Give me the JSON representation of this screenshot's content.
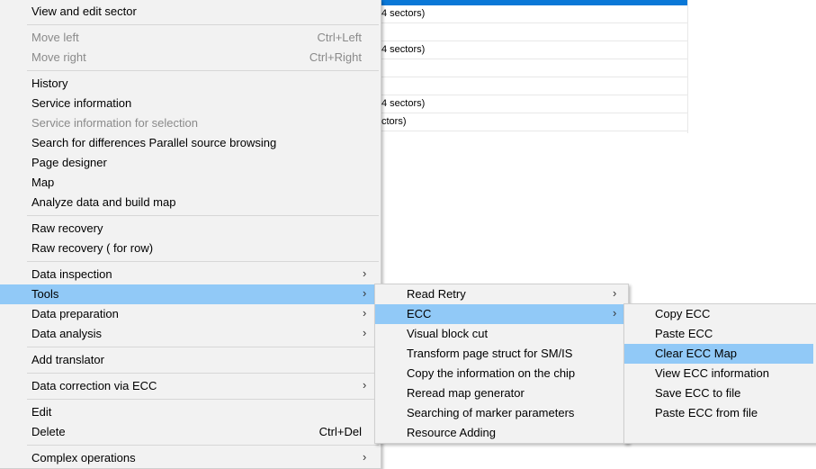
{
  "background": {
    "rows": [
      {
        "text": "4 sectors)"
      },
      {
        "text": ""
      },
      {
        "text": "4 sectors)"
      },
      {
        "text": ""
      },
      {
        "text": ""
      },
      {
        "text": "4 sectors)"
      },
      {
        "text": "ctors)"
      }
    ]
  },
  "main_menu": {
    "items": [
      {
        "label": "View and edit sector"
      },
      {
        "label": "Move left",
        "shortcut": "Ctrl+Left"
      },
      {
        "label": "Move right",
        "shortcut": "Ctrl+Right"
      },
      {
        "label": "History"
      },
      {
        "label": "Service information"
      },
      {
        "label": "Service information for selection"
      },
      {
        "label": "Search for differences Parallel source browsing"
      },
      {
        "label": "Page designer"
      },
      {
        "label": "Map"
      },
      {
        "label": "Analyze data and build map"
      },
      {
        "label": "Raw recovery"
      },
      {
        "label": "Raw recovery ( for row)"
      },
      {
        "label": "Data inspection"
      },
      {
        "label": "Tools"
      },
      {
        "label": "Data preparation"
      },
      {
        "label": "Data analysis"
      },
      {
        "label": "Add translator"
      },
      {
        "label": "Data correction via ECC"
      },
      {
        "label": "Edit"
      },
      {
        "label": "Delete",
        "shortcut": "Ctrl+Del"
      },
      {
        "label": "Complex operations"
      }
    ],
    "submenu_arrow": "chevron-right-icon"
  },
  "tools_menu": {
    "items": [
      {
        "label": "Read Retry"
      },
      {
        "label": "ECC"
      },
      {
        "label": "Visual block cut"
      },
      {
        "label": "Transform page struct for SM/IS"
      },
      {
        "label": "Copy the information on the chip"
      },
      {
        "label": "Reread map generator"
      },
      {
        "label": "Searching of marker parameters"
      },
      {
        "label": "Resource Adding"
      }
    ]
  },
  "ecc_menu": {
    "items": [
      {
        "label": "Copy ECC"
      },
      {
        "label": "Paste ECC"
      },
      {
        "label": "Clear ECC Map"
      },
      {
        "label": "View ECC information"
      },
      {
        "label": "Save ECC to file"
      },
      {
        "label": "Paste ECC from file"
      }
    ]
  },
  "colors": {
    "highlight": "#91c9f7",
    "menu_background": "#f2f2f2",
    "disabled_text": "#8a8a8a",
    "selection_bar": "#0a78d7"
  }
}
